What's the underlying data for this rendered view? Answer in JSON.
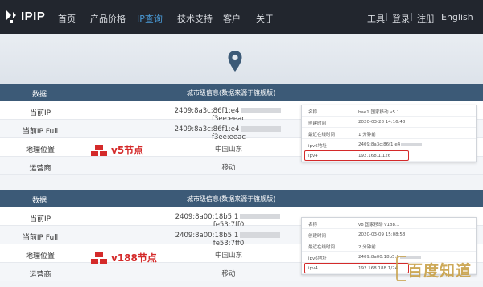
{
  "nav": {
    "logo_text": "IPIP",
    "items": [
      "首页",
      "产品价格",
      "IP查询",
      "技术支持",
      "客户",
      "关于"
    ],
    "right": [
      "工具",
      "登录",
      "注册",
      "English"
    ]
  },
  "panels": [
    {
      "head_label": "数据",
      "head_title": "城市级信息(数据来源于旗舰版)",
      "rows": [
        {
          "label": "当前IP",
          "value_a": "2409:8a3c:86f1:e4",
          "value_b": "f3ee:eeac"
        },
        {
          "label": "当前IP Full",
          "value_a": "2409:8a3c:86f1:e4",
          "value_b": "f3ee:eeac"
        },
        {
          "label": "地理位置",
          "value_a": "中国山东",
          "value_b": ""
        },
        {
          "label": "运营商",
          "value_a": "移动",
          "value_b": ""
        }
      ],
      "node_label": "v5节点",
      "card": {
        "rows": [
          {
            "k": "名称",
            "v": "bae1 国家移动 v5.1"
          },
          {
            "k": "创建时间",
            "v": "2020-03-28 14:16:48"
          },
          {
            "k": "最近在线时间",
            "v": "1 分钟前"
          },
          {
            "k": "ipv6地址",
            "v": "2409:8a3c:86f1:e4"
          },
          {
            "k": "ipv4",
            "v": "192.168.1.126"
          }
        ]
      }
    },
    {
      "head_label": "数据",
      "head_title": "城市级信息(数据来源于旗舰版)",
      "rows": [
        {
          "label": "当前IP",
          "value_a": "2409:8a00:18b5:1",
          "value_b": "fe53:7ff0"
        },
        {
          "label": "当前IP Full",
          "value_a": "2409:8a00:18b5:1",
          "value_b": "fe53:7ff0"
        },
        {
          "label": "地理位置",
          "value_a": "中国山东",
          "value_b": ""
        },
        {
          "label": "运营商",
          "value_a": "移动",
          "value_b": ""
        }
      ],
      "node_label": "v188节点",
      "card": {
        "rows": [
          {
            "k": "名称",
            "v": "v8 国家移动 v188.1"
          },
          {
            "k": "创建时间",
            "v": "2020-03-09 15:08:58"
          },
          {
            "k": "最近在线时间",
            "v": "2 分钟前"
          },
          {
            "k": "ipv6地址",
            "v": "2409:8a00:18b5:1"
          },
          {
            "k": "ipv4",
            "v": "192.168.188.1/24"
          }
        ]
      }
    }
  ],
  "watermark": "百度知道",
  "colors": {
    "nav_bg": "#22262e",
    "panel_head": "#3c5a77",
    "accent_red": "#d42a2a",
    "active_nav": "#4a9bd8"
  }
}
